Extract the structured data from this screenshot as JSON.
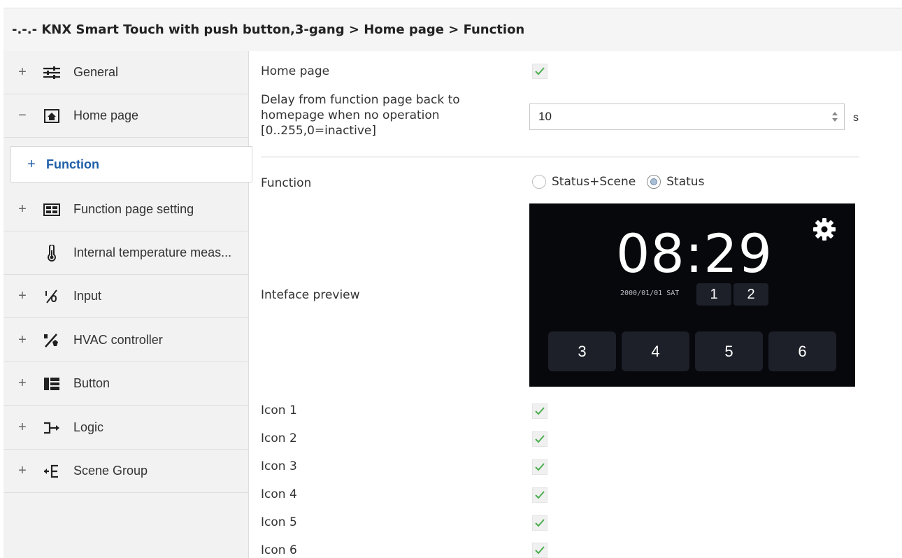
{
  "breadcrumb": "-.-.- KNX Smart Touch with push button,3-gang > Home page > Function",
  "sidebar": {
    "items": [
      {
        "expander": "+",
        "label": "General",
        "icon": "sliders-icon"
      },
      {
        "expander": "−",
        "label": "Home page",
        "icon": "home-icon"
      },
      {
        "expander": "+",
        "label": "Function",
        "icon": ""
      },
      {
        "expander": "+",
        "label": "Function page setting",
        "icon": "grid-icon"
      },
      {
        "expander": "",
        "label": "Internal temperature meas...",
        "icon": "thermometer-icon"
      },
      {
        "expander": "+",
        "label": "Input",
        "icon": "input-icon"
      },
      {
        "expander": "+",
        "label": "HVAC controller",
        "icon": "hvac-icon"
      },
      {
        "expander": "+",
        "label": "Button",
        "icon": "button-icon"
      },
      {
        "expander": "+",
        "label": "Logic",
        "icon": "logic-icon"
      },
      {
        "expander": "+",
        "label": "Scene Group",
        "icon": "scene-group-icon"
      }
    ]
  },
  "params": {
    "home_page_label": "Home page",
    "home_page_checked": true,
    "delay_label": "Delay from function page back to homepage when no operation [0..255,0=inactive]",
    "delay_value": "10",
    "delay_unit": "s",
    "function_label": "Function",
    "function_options": [
      "Status+Scene",
      "Status"
    ],
    "function_selected": "Status",
    "preview_label": "Inteface preview",
    "icons": [
      {
        "label": "Icon 1",
        "checked": true
      },
      {
        "label": "Icon 2",
        "checked": true
      },
      {
        "label": "Icon 3",
        "checked": true
      },
      {
        "label": "Icon 4",
        "checked": true
      },
      {
        "label": "Icon 5",
        "checked": true
      },
      {
        "label": "Icon 6",
        "checked": true
      }
    ]
  },
  "preview": {
    "time": "08:29",
    "date": "2000/01/01 SAT",
    "small_buttons": [
      "1",
      "2"
    ],
    "big_buttons": [
      "3",
      "4",
      "5",
      "6"
    ],
    "gear_icon": "gear-icon"
  },
  "colors": {
    "active_nav_text": "#1e5ea8",
    "check_green": "#4caf50",
    "preview_bg": "#06080c"
  }
}
